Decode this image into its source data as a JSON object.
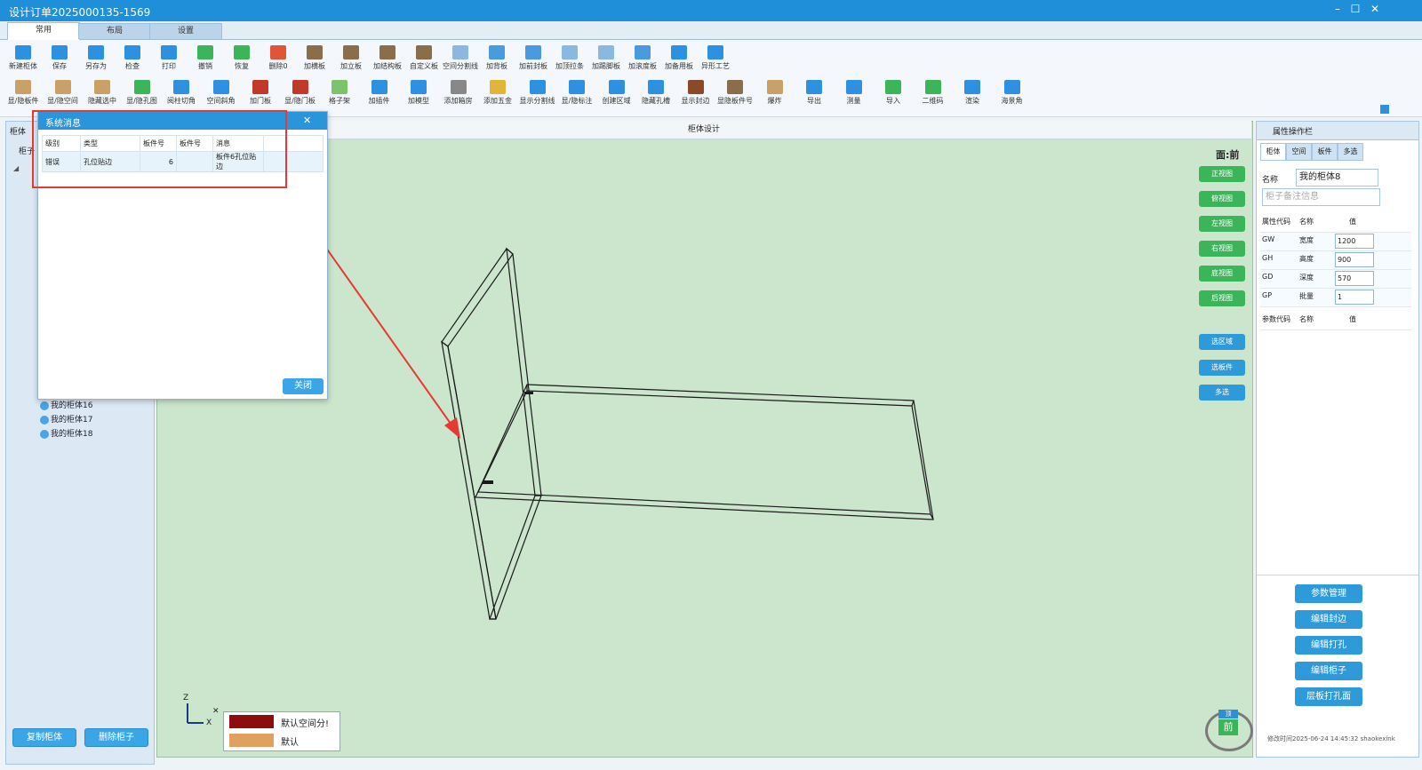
{
  "window": {
    "title": "设计订单2025000135-1569",
    "minimize": "–",
    "maximize": "☐",
    "close": "✕"
  },
  "tabs": [
    "常用",
    "布局",
    "设置"
  ],
  "toolbar_row1": [
    {
      "label": "新建柜体",
      "color": "#2e90e0"
    },
    {
      "label": "保存",
      "color": "#2e90e0"
    },
    {
      "label": "另存为",
      "color": "#2e90e0"
    },
    {
      "label": "检查",
      "color": "#2e90e0"
    },
    {
      "label": "打印",
      "color": "#2e90e0"
    },
    {
      "label": "撤销",
      "color": "#3cb55a"
    },
    {
      "label": "恢复",
      "color": "#3cb55a"
    },
    {
      "label": "删除0",
      "color": "#e0553a"
    },
    {
      "label": "加横板",
      "color": "#8a6d4a"
    },
    {
      "label": "加立板",
      "color": "#8a6d4a"
    },
    {
      "label": "加结构板",
      "color": "#8a6d4a"
    },
    {
      "label": "自定义板",
      "color": "#8a6d4a"
    },
    {
      "label": "空间分割线",
      "color": "#8ab8e0"
    },
    {
      "label": "加背板",
      "color": "#4a9ae0"
    },
    {
      "label": "加前封板",
      "color": "#4a9ae0"
    },
    {
      "label": "加顶拉条",
      "color": "#8ab8e0"
    },
    {
      "label": "加踢脚板",
      "color": "#8ab8e0"
    },
    {
      "label": "加滚度板",
      "color": "#4a9ae0"
    },
    {
      "label": "加备用板",
      "color": "#2e90e0"
    },
    {
      "label": "异形工艺",
      "color": "#2e90e0"
    }
  ],
  "toolbar_row2": [
    {
      "label": "显/隐板件",
      "color": "#c9a066"
    },
    {
      "label": "显/隐空间",
      "color": "#c9a066"
    },
    {
      "label": "隐藏选中",
      "color": "#c9a066"
    },
    {
      "label": "显/隐孔图",
      "color": "#3cb55a"
    },
    {
      "label": "阅柱切角",
      "color": "#2e90e0"
    },
    {
      "label": "空间斜角",
      "color": "#2e90e0"
    },
    {
      "label": "加门板",
      "color": "#c0392b"
    },
    {
      "label": "显/隐门板",
      "color": "#c0392b"
    },
    {
      "label": "格子架",
      "color": "#7dc36b"
    },
    {
      "label": "加插件",
      "color": "#2e90e0"
    },
    {
      "label": "加模型",
      "color": "#2e90e0"
    },
    {
      "label": "添加箱房",
      "color": "#888888"
    },
    {
      "label": "添加五金",
      "color": "#e0b53a"
    },
    {
      "label": "显示分割线",
      "color": "#2e90e0"
    },
    {
      "label": "显/隐标注",
      "color": "#2e90e0"
    },
    {
      "label": "创建区域",
      "color": "#2e90e0"
    },
    {
      "label": "隐藏孔槽",
      "color": "#2e90e0"
    },
    {
      "label": "显示封边",
      "color": "#8a4a2a"
    },
    {
      "label": "显隐板件号",
      "color": "#8a6d4a"
    },
    {
      "label": "爆炸",
      "color": "#c9a066"
    },
    {
      "label": "导出",
      "color": "#2e90e0"
    },
    {
      "label": "测量",
      "color": "#2e90e0"
    },
    {
      "label": "导入",
      "color": "#3cb55a"
    },
    {
      "label": "二维码",
      "color": "#3cb55a"
    },
    {
      "label": "渲染",
      "color": "#2e90e0"
    },
    {
      "label": "海景角",
      "color": "#2e90e0"
    }
  ],
  "left_panel": {
    "header": "柜体",
    "subheader": "柜子",
    "items": [
      "我的柜体16",
      "我的柜体17",
      "我的柜体18"
    ],
    "copy_button": "复制柜体",
    "delete_button": "删除柜子"
  },
  "canvas": {
    "title": "柜体设计",
    "face_label": "面:前",
    "view_buttons": [
      "正视图",
      "俯视图",
      "左视图",
      "右视图",
      "底视图",
      "后视图"
    ],
    "select_buttons": [
      "选区域",
      "选板件",
      "多选"
    ],
    "legend": [
      {
        "label": "默认空间分!",
        "color": "#8b0d0d"
      },
      {
        "label": "默认",
        "color": "#e0a060"
      }
    ],
    "axes": {
      "z": "Z",
      "x": "X",
      "close": "✕"
    },
    "cube": {
      "top": "顶",
      "front": "前"
    }
  },
  "right_panel": {
    "header": "属性操作栏",
    "tabs": [
      "柜体",
      "空间",
      "板件",
      "多选"
    ],
    "name_label": "名称",
    "name_value": "我的柜体8",
    "note_placeholder": "柜子备注信息",
    "attr_headers": [
      "属性代码",
      "名称",
      "值"
    ],
    "attrs": [
      {
        "code": "GW",
        "name": "宽度",
        "value": "1200"
      },
      {
        "code": "GH",
        "name": "高度",
        "value": "900"
      },
      {
        "code": "GD",
        "name": "深度",
        "value": "570"
      },
      {
        "code": "GP",
        "name": "批量",
        "value": "1"
      }
    ],
    "param_headers": [
      "参数代码",
      "名称",
      "值"
    ],
    "buttons": [
      "参数管理",
      "编辑封边",
      "编辑打孔",
      "编辑柜子",
      "层板打孔面"
    ],
    "footer": "修改时间2025-06-24 14:45:32 shaokexink"
  },
  "dialog": {
    "title": "系统消息",
    "close_x": "✕",
    "headers": [
      "级别",
      "类型",
      "板件号",
      "板件号",
      "消息"
    ],
    "rows": [
      [
        "错误",
        "孔位贴边",
        "6",
        "",
        "板件6孔位贴边"
      ]
    ],
    "close_button": "关闭"
  }
}
